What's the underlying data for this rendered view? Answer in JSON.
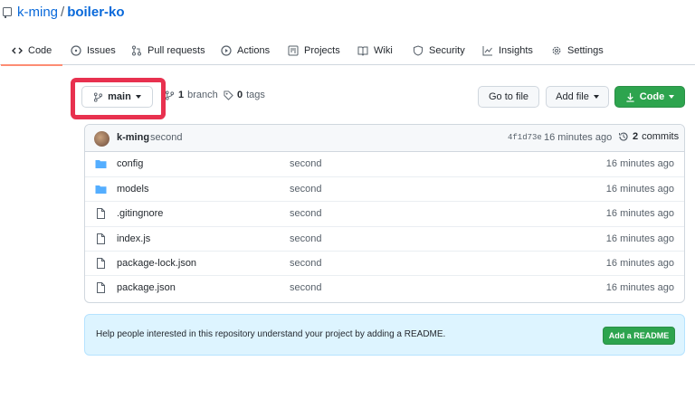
{
  "repo": {
    "owner": "k-ming",
    "separator": "/",
    "name": "boiler-ko"
  },
  "tabs": [
    {
      "label": "Code",
      "icon": "code-icon",
      "active": true
    },
    {
      "label": "Issues",
      "icon": "issue-icon"
    },
    {
      "label": "Pull requests",
      "icon": "pull-request-icon"
    },
    {
      "label": "Actions",
      "icon": "play-icon"
    },
    {
      "label": "Projects",
      "icon": "project-icon"
    },
    {
      "label": "Wiki",
      "icon": "book-icon"
    },
    {
      "label": "Security",
      "icon": "shield-icon"
    },
    {
      "label": "Insights",
      "icon": "graph-icon"
    },
    {
      "label": "Settings",
      "icon": "gear-icon"
    }
  ],
  "branch": {
    "current": "main",
    "branch_count": "1",
    "branch_label": "branch",
    "tag_count": "0",
    "tag_label": "tags"
  },
  "actions": {
    "goto_file": "Go to file",
    "add_file": "Add file",
    "code": "Code"
  },
  "latest_commit": {
    "author": "k-ming",
    "message": "second",
    "sha": "4f1d73e",
    "time": "16 minutes ago",
    "count": "2",
    "count_label": "commits"
  },
  "files": [
    {
      "type": "dir",
      "name": "config",
      "message": "second",
      "age": "16 minutes ago"
    },
    {
      "type": "dir",
      "name": "models",
      "message": "second",
      "age": "16 minutes ago"
    },
    {
      "type": "file",
      "name": ".gitingnore",
      "message": "second",
      "age": "16 minutes ago"
    },
    {
      "type": "file",
      "name": "index.js",
      "message": "second",
      "age": "16 minutes ago"
    },
    {
      "type": "file",
      "name": "package-lock.json",
      "message": "second",
      "age": "16 minutes ago"
    },
    {
      "type": "file",
      "name": "package.json",
      "message": "second",
      "age": "16 minutes ago"
    }
  ],
  "readme": {
    "text": "Help people interested in this repository understand your project by adding a README.",
    "button": "Add a README"
  },
  "colors": {
    "accent": "#0969da",
    "primary_button": "#2da44e",
    "highlight": "#e8314f",
    "folder": "#54aeff",
    "tab_underline": "#fd8c73"
  }
}
